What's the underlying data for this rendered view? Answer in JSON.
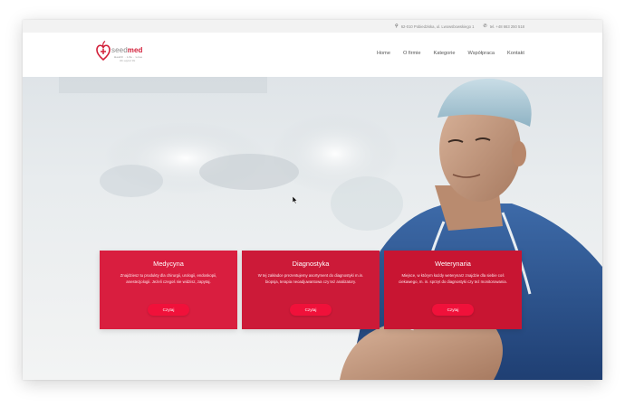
{
  "topbar": {
    "address": "62-010 Pobiedziska, ul. Lwowsbowskiego 1",
    "phone": "tel. +48 663 250 518"
  },
  "logo": {
    "word_light": "seed",
    "word_bold": "med",
    "tagline": "Health · Life · Love",
    "subline": "We support life"
  },
  "nav": {
    "items": [
      "Home",
      "O firmie",
      "Kategorie",
      "Współpraca",
      "Kontakt"
    ]
  },
  "cards": [
    {
      "title": "Medycyna",
      "description": "Znajdziesz tu produkty dla chirurgii, urologii, endoskopii, anestezjologii. Jeżeli czegoś nie widzisz, zapytaj.",
      "button": "Czytaj"
    },
    {
      "title": "Diagnostyka",
      "description": "W tej zakładce prezentujemy asortyment do diagnostyki m.in. biopsja, terapia neoadjuwantowa czy też analizatory.",
      "button": "Czytaj"
    },
    {
      "title": "Weterynaria",
      "description": "Miejsce, w którym każdy weterynarz znajdzie dla siebie coś ciekawego, m. in. sprzęt do diagnostyki czy też monitorowania.",
      "button": "Czytaj"
    }
  ],
  "colors": {
    "brand_red": "#d2203a",
    "card_red": "#d91e3f",
    "button_red": "#f0113a"
  }
}
